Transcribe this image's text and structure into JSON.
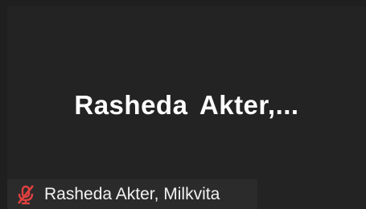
{
  "participant": {
    "display_name": "Rasheda  Akter,...",
    "name_tag": "Rasheda Akter, Milkvita",
    "mic_icon": "mic-muted-icon"
  },
  "colors": {
    "background": "#1f1f1f",
    "tile": "#232323",
    "name_tag_bg": "#2b2b2b",
    "muted_red": "#e0403f"
  }
}
